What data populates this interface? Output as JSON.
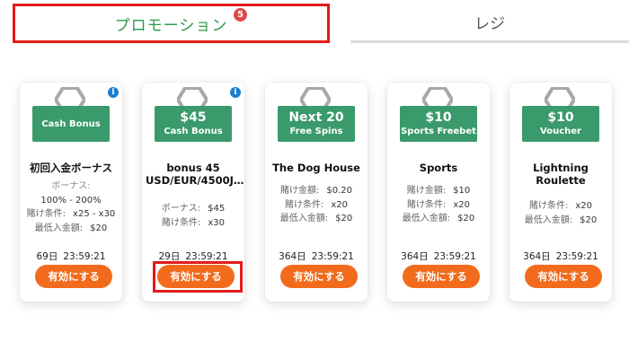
{
  "tabs": {
    "promotion": {
      "label": "プロモーション",
      "badge": "5"
    },
    "cashier": {
      "label": "レジ"
    }
  },
  "cards": [
    {
      "banner_line1": "Cash Bonus",
      "title": "初回入金ボーナス",
      "details_stacked": {
        "label": "ボーナス:",
        "value": "100% - 200%"
      },
      "details": [
        {
          "key": "賭け条件:",
          "value": "x25 - x30"
        },
        {
          "key": "最低入金額:",
          "value": "$20"
        }
      ],
      "timer_days": "69日",
      "timer_time": "23:59:21",
      "button": "有効にする",
      "info": "i"
    },
    {
      "banner_line1": "$45",
      "banner_line2": "Cash Bonus",
      "title": "bonus 45 USD/EUR/4500J…",
      "details": [
        {
          "key": "ボーナス:",
          "value": "$45"
        },
        {
          "key": "賭け条件:",
          "value": "x30"
        }
      ],
      "timer_days": "29日",
      "timer_time": "23:59:21",
      "button": "有効にする",
      "info": "i"
    },
    {
      "banner_line1": "Next 20",
      "banner_line2": "Free Spins",
      "title": "The Dog House",
      "details": [
        {
          "key": "賭け金額:",
          "value": "$0.20"
        },
        {
          "key": "賭け条件:",
          "value": "x20"
        },
        {
          "key": "最低入金額:",
          "value": "$20"
        }
      ],
      "timer_days": "364日",
      "timer_time": "23:59:21",
      "button": "有効にする"
    },
    {
      "banner_line1": "$10",
      "banner_line2": "Sports Freebet",
      "title": "Sports",
      "details": [
        {
          "key": "賭け金額:",
          "value": "$10"
        },
        {
          "key": "賭け条件:",
          "value": "x20"
        },
        {
          "key": "最低入金額:",
          "value": "$20"
        }
      ],
      "timer_days": "364日",
      "timer_time": "23:59:21",
      "button": "有効にする"
    },
    {
      "banner_line1": "$10",
      "banner_line2": "Voucher",
      "title": "Lightning Roulette",
      "details": [
        {
          "key": "賭け条件:",
          "value": "x20"
        },
        {
          "key": "最低入金額:",
          "value": "$20"
        }
      ],
      "timer_days": "364日",
      "timer_time": "23:59:21",
      "button": "有効にする"
    }
  ],
  "colors": {
    "accent_green": "#2e9a4a",
    "banner_green": "#3a9a6c",
    "button_orange": "#f26b1d",
    "highlight_red": "#e51a1a",
    "badge_red": "#e04848",
    "info_blue": "#1a7fd0"
  },
  "icons": {
    "info": "info-icon",
    "banner_decoration": "hexagon-icon"
  }
}
